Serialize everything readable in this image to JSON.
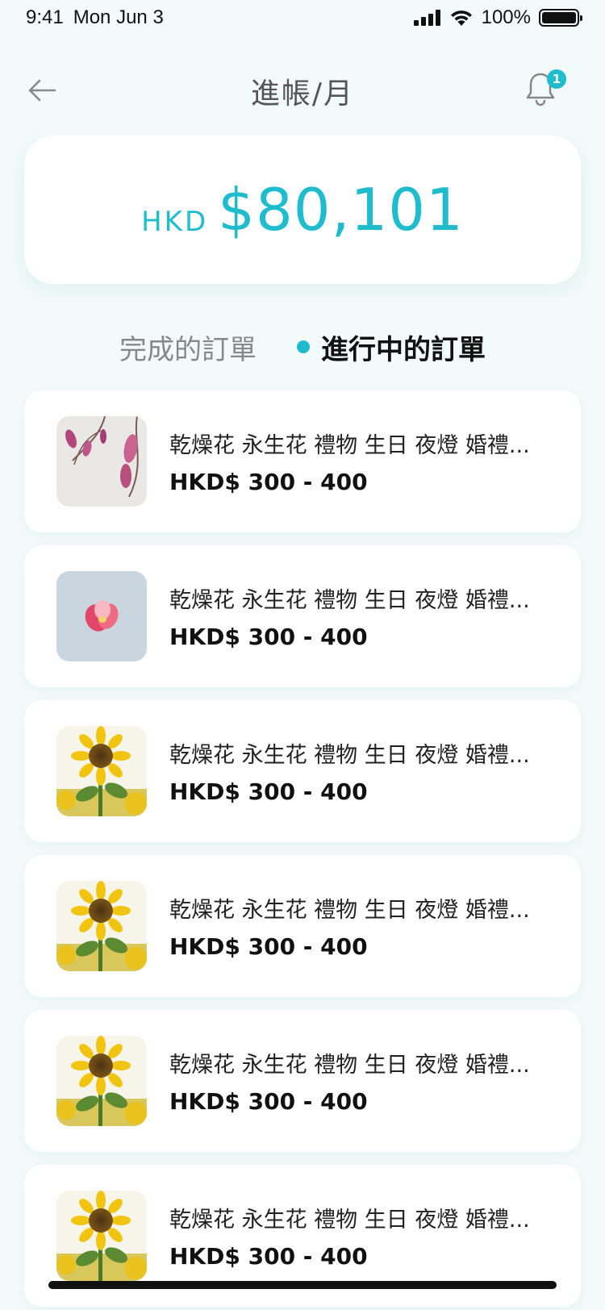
{
  "status_bar": {
    "time": "9:41",
    "date": "Mon Jun 3",
    "battery": "100%"
  },
  "header": {
    "title": "進帳/月",
    "notification_count": "1"
  },
  "balance": {
    "currency": "HKD",
    "amount": "$80,101"
  },
  "tabs": [
    {
      "label": "完成的訂單",
      "active": false
    },
    {
      "label": "進行中的訂單",
      "active": true
    }
  ],
  "orders": [
    {
      "title": "乾燥花 永生花 禮物 生日 夜燈 婚禮...",
      "price": "HKD$ 300 - 400",
      "image": "magnolia"
    },
    {
      "title": "乾燥花 永生花 禮物 生日 夜燈 婚禮...",
      "price": "HKD$ 300 - 400",
      "image": "pink-flower"
    },
    {
      "title": "乾燥花 永生花 禮物 生日 夜燈 婚禮...",
      "price": "HKD$ 300 - 400",
      "image": "sunflower"
    },
    {
      "title": "乾燥花 永生花 禮物 生日 夜燈 婚禮...",
      "price": "HKD$ 300 - 400",
      "image": "sunflower"
    },
    {
      "title": "乾燥花 永生花 禮物 生日 夜燈 婚禮...",
      "price": "HKD$ 300 - 400",
      "image": "sunflower"
    },
    {
      "title": "乾燥花 永生花 禮物 生日 夜燈 婚禮...",
      "price": "HKD$ 300 - 400",
      "image": "sunflower"
    }
  ],
  "colors": {
    "accent": "#1fbccd",
    "background": "#f3fafa"
  },
  "icons": {
    "back": "arrow-left-icon",
    "notification": "bell-icon"
  }
}
